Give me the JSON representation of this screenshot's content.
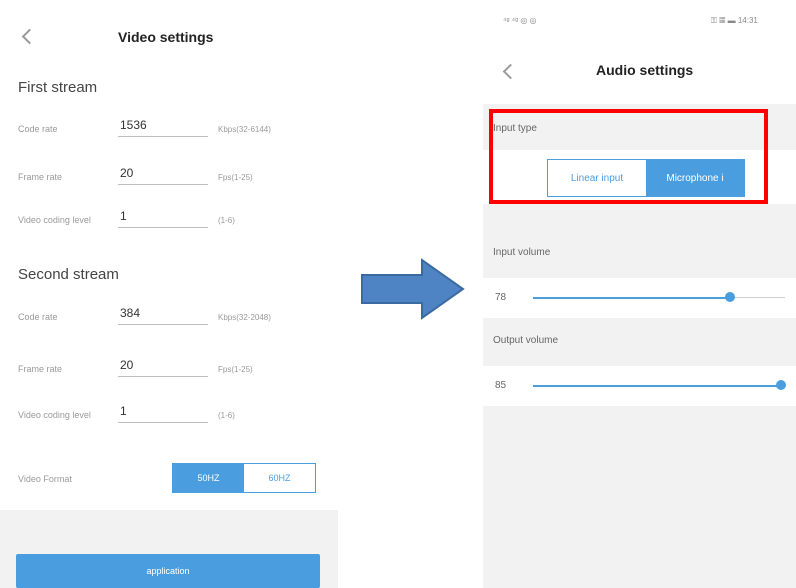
{
  "left": {
    "title": "Video settings",
    "first_stream": {
      "heading": "First stream",
      "rows": [
        {
          "label": "Code rate",
          "value": "1536",
          "hint": "Kbps(32-6144)"
        },
        {
          "label": "Frame rate",
          "value": "20",
          "hint": "Fps(1-25)"
        },
        {
          "label": "Video coding level",
          "value": "1",
          "hint": "(1-6)"
        }
      ]
    },
    "second_stream": {
      "heading": "Second stream",
      "rows": [
        {
          "label": "Code rate",
          "value": "384",
          "hint": "Kbps(32-2048)"
        },
        {
          "label": "Frame rate",
          "value": "20",
          "hint": "Fps(1-25)"
        },
        {
          "label": "Video coding level",
          "value": "1",
          "hint": "(1-6)"
        }
      ]
    },
    "video_format": {
      "label": "Video Format",
      "options": [
        "50HZ",
        "60HZ"
      ],
      "selected_index": 0
    },
    "apply_label": "application"
  },
  "right": {
    "status_left": "⁴ᵍ ⁴ᵍ ◎ ◎",
    "status_right": "⚿ ▦ ▬ 14:31",
    "title": "Audio settings",
    "input_type": {
      "label": "Input type",
      "options": [
        "Linear input",
        "Microphone i"
      ],
      "selected_index": 1
    },
    "input_volume": {
      "label": "Input volume",
      "value": "78",
      "level": 0.78
    },
    "output_volume": {
      "label": "Output volume",
      "value": "85",
      "level": 0.985
    }
  },
  "colors": {
    "accent": "#4a9ee0",
    "highlight": "#ff0000",
    "arrow_fill": "#4f84c4",
    "arrow_stroke": "#3b6aa3"
  },
  "icons": {
    "back": "chevron-left-icon",
    "arrow": "right-arrow-icon"
  }
}
